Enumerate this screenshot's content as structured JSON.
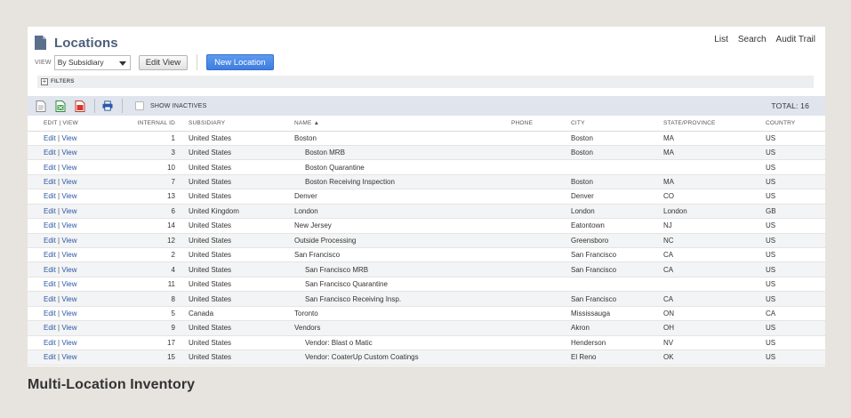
{
  "header": {
    "title": "Locations",
    "links": [
      "List",
      "Search",
      "Audit Trail"
    ]
  },
  "view": {
    "label": "VIEW",
    "selected": "By Subsidiary",
    "edit_view_label": "Edit View",
    "new_location_label": "New Location"
  },
  "filters": {
    "label": "FILTERS"
  },
  "toolbar": {
    "icons": [
      "document-icon",
      "excel-icon",
      "pdf-icon",
      "print-icon"
    ],
    "show_inactives_label": "SHOW INACTIVES",
    "total_label": "TOTAL: 16"
  },
  "table": {
    "columns": [
      "EDIT | VIEW",
      "INTERNAL ID",
      "SUBSIDIARY",
      "NAME ▲",
      "PHONE",
      "CITY",
      "STATE/PROVINCE",
      "COUNTRY"
    ],
    "edit_label": "Edit",
    "view_label": "View",
    "rows": [
      {
        "id": "1",
        "subsidiary": "United States",
        "name": "Boston",
        "child": false,
        "phone": "",
        "city": "Boston",
        "state": "MA",
        "country": "US"
      },
      {
        "id": "3",
        "subsidiary": "United States",
        "name": "Boston MRB",
        "child": true,
        "phone": "",
        "city": "Boston",
        "state": "MA",
        "country": "US"
      },
      {
        "id": "10",
        "subsidiary": "United States",
        "name": "Boston Quarantine",
        "child": true,
        "phone": "",
        "city": "",
        "state": "",
        "country": "US"
      },
      {
        "id": "7",
        "subsidiary": "United States",
        "name": "Boston Receiving Inspection",
        "child": true,
        "phone": "",
        "city": "Boston",
        "state": "MA",
        "country": "US"
      },
      {
        "id": "13",
        "subsidiary": "United States",
        "name": "Denver",
        "child": false,
        "phone": "",
        "city": "Denver",
        "state": "CO",
        "country": "US"
      },
      {
        "id": "6",
        "subsidiary": "United Kingdom",
        "name": "London",
        "child": false,
        "phone": "",
        "city": "London",
        "state": "London",
        "country": "GB"
      },
      {
        "id": "14",
        "subsidiary": "United States",
        "name": "New Jersey",
        "child": false,
        "phone": "",
        "city": "Eatontown",
        "state": "NJ",
        "country": "US"
      },
      {
        "id": "12",
        "subsidiary": "United States",
        "name": "Outside Processing",
        "child": false,
        "phone": "",
        "city": "Greensboro",
        "state": "NC",
        "country": "US"
      },
      {
        "id": "2",
        "subsidiary": "United States",
        "name": "San Francisco",
        "child": false,
        "phone": "",
        "city": "San Francisco",
        "state": "CA",
        "country": "US"
      },
      {
        "id": "4",
        "subsidiary": "United States",
        "name": "San Francisco MRB",
        "child": true,
        "phone": "",
        "city": "San Francisco",
        "state": "CA",
        "country": "US"
      },
      {
        "id": "11",
        "subsidiary": "United States",
        "name": "San Francisco Quarantine",
        "child": true,
        "phone": "",
        "city": "",
        "state": "",
        "country": "US"
      },
      {
        "id": "8",
        "subsidiary": "United States",
        "name": "San Francisco Receiving Insp.",
        "child": true,
        "phone": "",
        "city": "San Francisco",
        "state": "CA",
        "country": "US"
      },
      {
        "id": "5",
        "subsidiary": "Canada",
        "name": "Toronto",
        "child": false,
        "phone": "",
        "city": "Mississauga",
        "state": "ON",
        "country": "CA"
      },
      {
        "id": "9",
        "subsidiary": "United States",
        "name": "Vendors",
        "child": false,
        "phone": "",
        "city": "Akron",
        "state": "OH",
        "country": "US"
      },
      {
        "id": "17",
        "subsidiary": "United States",
        "name": "Vendor: Blast o Matic",
        "child": true,
        "phone": "",
        "city": "Henderson",
        "state": "NV",
        "country": "US"
      },
      {
        "id": "15",
        "subsidiary": "United States",
        "name": "Vendor: CoaterUp Custom Coatings",
        "child": true,
        "phone": "",
        "city": "El Reno",
        "state": "OK",
        "country": "US"
      }
    ]
  },
  "caption": "Multi-Location Inventory",
  "colors": {
    "title": "#4d5f79",
    "link": "#2b58a8",
    "primary_button": "#3f7de0",
    "toolbar_bg": "#dfe4ed",
    "page_bg": "#e7e4df"
  }
}
